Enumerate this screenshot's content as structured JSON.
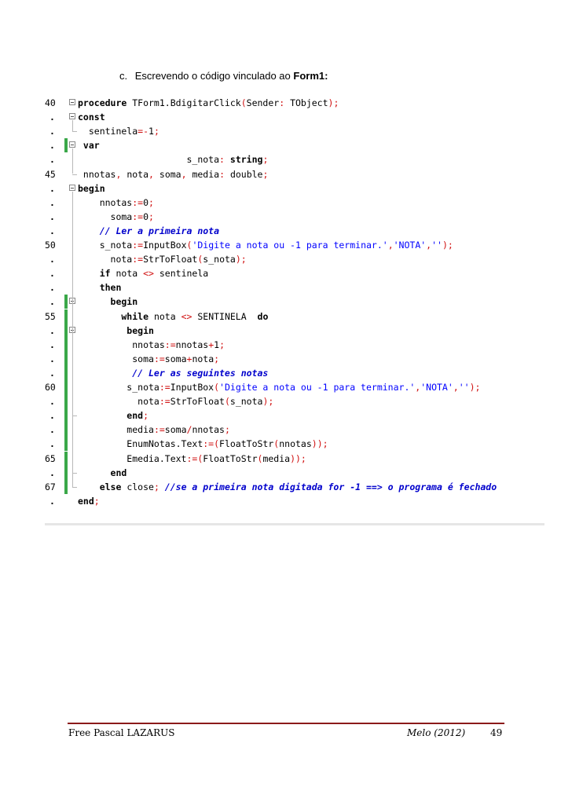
{
  "heading": {
    "label": "c.",
    "text": "Escrevendo o código vinculado ao",
    "bold": "Form1:"
  },
  "code": {
    "lines": [
      {
        "n": "40",
        "segs": [
          [
            "kw",
            "procedure"
          ],
          [
            "t",
            " TForm1.BdigitarClick"
          ],
          [
            "sym",
            "("
          ],
          [
            "t",
            "Sender"
          ],
          [
            "sym",
            ":"
          ],
          [
            "t",
            " TObject"
          ],
          [
            "sym",
            ");"
          ]
        ]
      },
      {
        "n": ".",
        "segs": [
          [
            "kw",
            "const"
          ]
        ]
      },
      {
        "n": ".",
        "segs": [
          [
            "t",
            "  sentinela"
          ],
          [
            "sym",
            "=-"
          ],
          [
            "num",
            "1"
          ],
          [
            "sym",
            ";"
          ]
        ]
      },
      {
        "n": ".",
        "segs": [
          [
            "kw",
            " var"
          ]
        ]
      },
      {
        "n": ".",
        "segs": [
          [
            "t",
            "                    s_nota"
          ],
          [
            "sym",
            ":"
          ],
          [
            "t",
            " "
          ],
          [
            "kw",
            "string"
          ],
          [
            "sym",
            ";"
          ]
        ]
      },
      {
        "n": "45",
        "segs": [
          [
            "t",
            " nnotas"
          ],
          [
            "sym",
            ","
          ],
          [
            "t",
            " nota"
          ],
          [
            "sym",
            ","
          ],
          [
            "t",
            " soma"
          ],
          [
            "sym",
            ","
          ],
          [
            "t",
            " media"
          ],
          [
            "sym",
            ":"
          ],
          [
            "t",
            " double"
          ],
          [
            "sym",
            ";"
          ]
        ]
      },
      {
        "n": ".",
        "segs": [
          [
            "kw",
            "begin"
          ]
        ]
      },
      {
        "n": ".",
        "segs": [
          [
            "t",
            "    nnotas"
          ],
          [
            "sym",
            ":="
          ],
          [
            "num",
            "0"
          ],
          [
            "sym",
            ";"
          ]
        ]
      },
      {
        "n": ".",
        "segs": [
          [
            "t",
            "      soma"
          ],
          [
            "sym",
            ":="
          ],
          [
            "num",
            "0"
          ],
          [
            "sym",
            ";"
          ]
        ]
      },
      {
        "n": ".",
        "segs": [
          [
            "cm",
            "    // Ler a primeira nota"
          ]
        ]
      },
      {
        "n": "50",
        "segs": [
          [
            "t",
            "    s_nota"
          ],
          [
            "sym",
            ":="
          ],
          [
            "t",
            "InputBox"
          ],
          [
            "sym",
            "("
          ],
          [
            "str",
            "'Digite a nota ou -1 para terminar.'"
          ],
          [
            "sym",
            ","
          ],
          [
            "str",
            "'NOTA'"
          ],
          [
            "sym",
            ","
          ],
          [
            "str",
            "''"
          ],
          [
            "sym",
            ");"
          ]
        ]
      },
      {
        "n": ".",
        "segs": [
          [
            "t",
            "      nota"
          ],
          [
            "sym",
            ":="
          ],
          [
            "t",
            "StrToFloat"
          ],
          [
            "sym",
            "("
          ],
          [
            "t",
            "s_nota"
          ],
          [
            "sym",
            ");"
          ]
        ]
      },
      {
        "n": ".",
        "segs": [
          [
            "kw",
            "    if"
          ],
          [
            "t",
            " nota "
          ],
          [
            "sym",
            "<>"
          ],
          [
            "t",
            " sentinela"
          ]
        ]
      },
      {
        "n": ".",
        "segs": [
          [
            "kw",
            "    then"
          ]
        ]
      },
      {
        "n": ".",
        "segs": [
          [
            "kw",
            "      begin"
          ]
        ]
      },
      {
        "n": "55",
        "segs": [
          [
            "kw",
            "        while"
          ],
          [
            "t",
            " nota "
          ],
          [
            "sym",
            "<>"
          ],
          [
            "t",
            " SENTINELA  "
          ],
          [
            "kw",
            "do"
          ]
        ]
      },
      {
        "n": ".",
        "segs": [
          [
            "kw",
            "         begin"
          ]
        ]
      },
      {
        "n": ".",
        "segs": [
          [
            "t",
            "          nnotas"
          ],
          [
            "sym",
            ":="
          ],
          [
            "t",
            "nnotas"
          ],
          [
            "sym",
            "+"
          ],
          [
            "num",
            "1"
          ],
          [
            "sym",
            ";"
          ]
        ]
      },
      {
        "n": ".",
        "segs": [
          [
            "t",
            "          soma"
          ],
          [
            "sym",
            ":="
          ],
          [
            "t",
            "soma"
          ],
          [
            "sym",
            "+"
          ],
          [
            "t",
            "nota"
          ],
          [
            "sym",
            ";"
          ]
        ]
      },
      {
        "n": ".",
        "segs": [
          [
            "cm",
            "          // Ler as seguintes notas"
          ]
        ]
      },
      {
        "n": "60",
        "segs": [
          [
            "t",
            "         s_nota"
          ],
          [
            "sym",
            ":="
          ],
          [
            "t",
            "InputBox"
          ],
          [
            "sym",
            "("
          ],
          [
            "str",
            "'Digite a nota ou -1 para terminar.'"
          ],
          [
            "sym",
            ","
          ],
          [
            "str",
            "'NOTA'"
          ],
          [
            "sym",
            ","
          ],
          [
            "str",
            "''"
          ],
          [
            "sym",
            ");"
          ]
        ]
      },
      {
        "n": ".",
        "segs": [
          [
            "t",
            "           nota"
          ],
          [
            "sym",
            ":="
          ],
          [
            "t",
            "StrToFloat"
          ],
          [
            "sym",
            "("
          ],
          [
            "t",
            "s_nota"
          ],
          [
            "sym",
            ");"
          ]
        ]
      },
      {
        "n": ".",
        "segs": [
          [
            "kw",
            "         end"
          ],
          [
            "sym",
            ";"
          ]
        ]
      },
      {
        "n": ".",
        "segs": [
          [
            "t",
            "         media"
          ],
          [
            "sym",
            ":="
          ],
          [
            "t",
            "soma"
          ],
          [
            "sym",
            "/"
          ],
          [
            "t",
            "nnotas"
          ],
          [
            "sym",
            ";"
          ]
        ]
      },
      {
        "n": ".",
        "segs": [
          [
            "t",
            "         EnumNotas.Text"
          ],
          [
            "sym",
            ":=("
          ],
          [
            "t",
            "FloatToStr"
          ],
          [
            "sym",
            "("
          ],
          [
            "t",
            "nnotas"
          ],
          [
            "sym",
            "));"
          ]
        ]
      },
      {
        "n": "65",
        "segs": [
          [
            "t",
            "         Emedia.Text"
          ],
          [
            "sym",
            ":=("
          ],
          [
            "t",
            "FloatToStr"
          ],
          [
            "sym",
            "("
          ],
          [
            "t",
            "media"
          ],
          [
            "sym",
            "));"
          ]
        ]
      },
      {
        "n": ".",
        "segs": [
          [
            "kw",
            "      end"
          ]
        ]
      },
      {
        "n": "67",
        "segs": [
          [
            "kw",
            "    else"
          ],
          [
            "t",
            " close"
          ],
          [
            "sym",
            ";"
          ],
          [
            "cm",
            " //se a primeira nota digitada for -1 ==> o programa é fechado"
          ]
        ]
      },
      {
        "n": ".",
        "segs": [
          [
            "kw",
            "end"
          ],
          [
            "sym",
            ";"
          ]
        ]
      }
    ]
  },
  "footer": {
    "left": "Free Pascal LAZARUS",
    "right": "Melo (2012)",
    "page": "49"
  }
}
